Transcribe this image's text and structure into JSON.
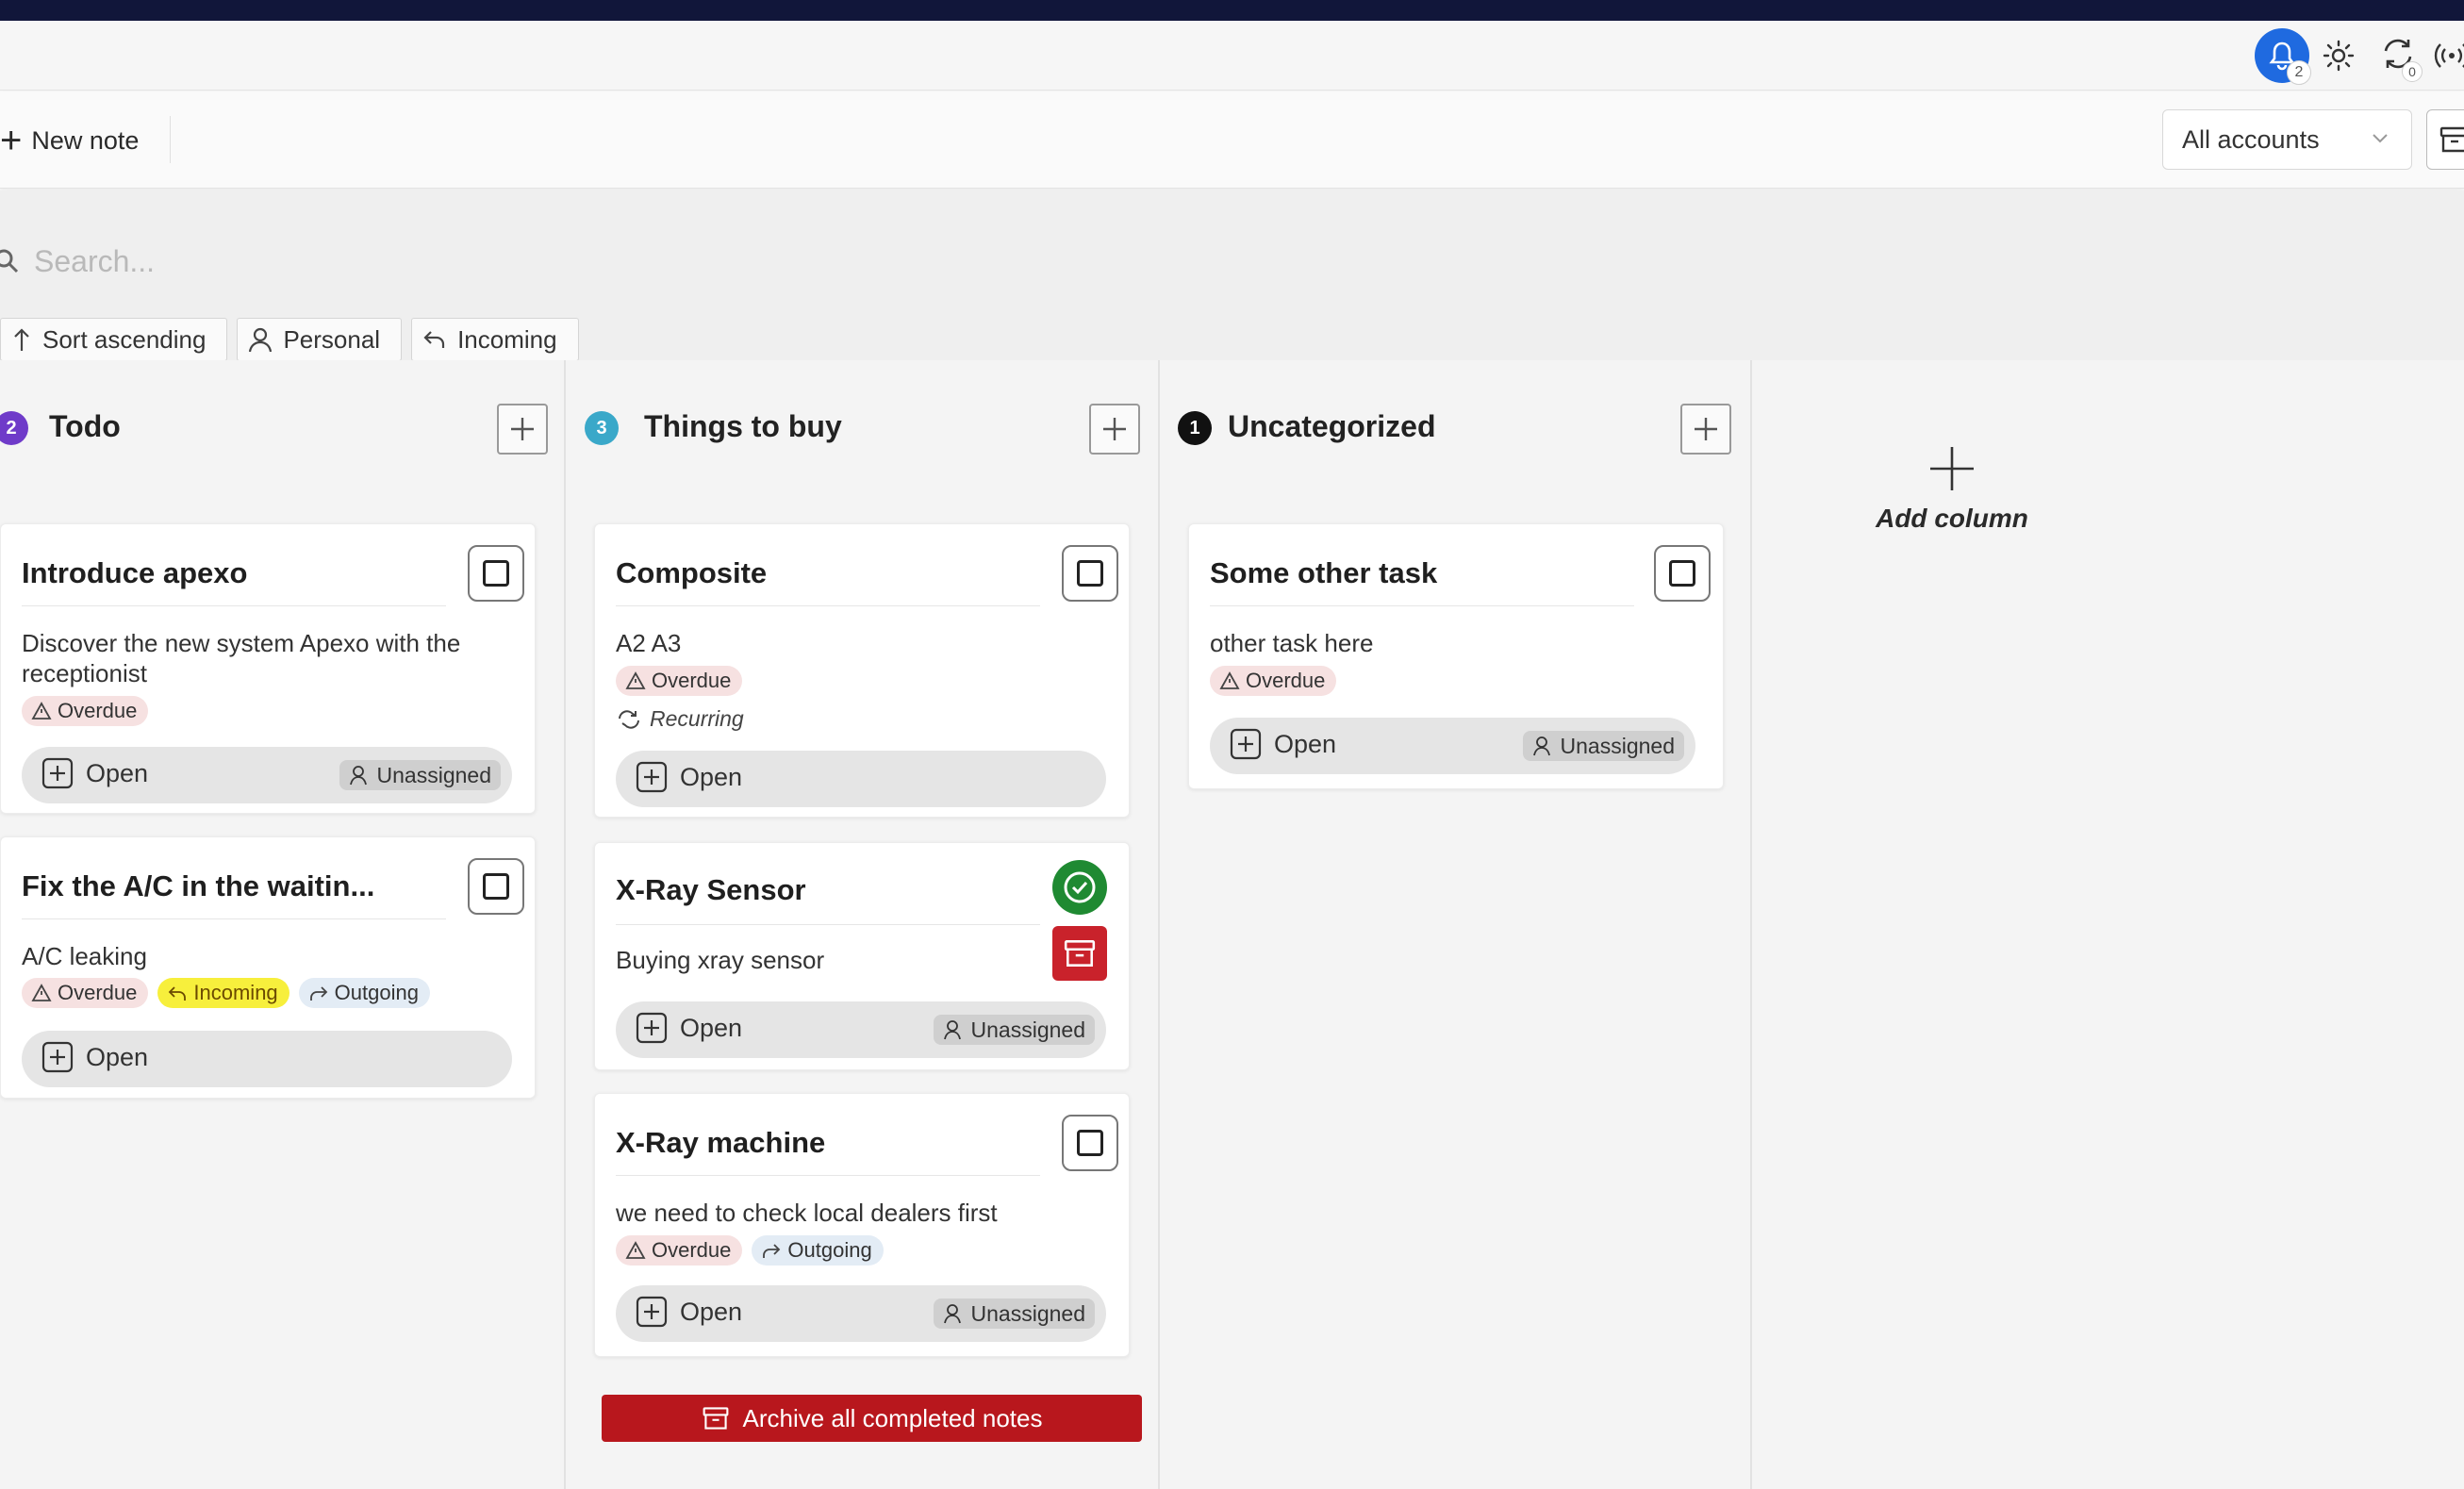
{
  "titlebar": {
    "notifications_count": "2",
    "sync_count": "0"
  },
  "toolbar": {
    "new_note_label": "New note",
    "account_select_value": "All accounts"
  },
  "search": {
    "placeholder": "Search..."
  },
  "filters": [
    {
      "label": "Sort ascending",
      "icon": "arrow-up-icon"
    },
    {
      "label": "Personal",
      "icon": "person-icon"
    },
    {
      "label": "Incoming",
      "icon": "reply-icon"
    }
  ],
  "columns": [
    {
      "title": "Todo",
      "count": "2",
      "count_color": "#6f3bc9",
      "cards": [
        {
          "title": "Introduce apexo",
          "description": "Discover the new system Apexo with the receptionist",
          "tags": [
            "Overdue"
          ],
          "open_label": "Open",
          "assignee": "Unassigned"
        },
        {
          "title": "Fix the A/C in the waitin...",
          "description": "A/C leaking",
          "tags": [
            "Overdue",
            "Incoming",
            "Outgoing"
          ],
          "open_label": "Open"
        }
      ]
    },
    {
      "title": "Things to buy",
      "count": "3",
      "count_color": "#3aa8c9",
      "cards": [
        {
          "title": "Composite",
          "description": "A2 A3",
          "tags": [
            "Overdue"
          ],
          "recurring": "Recurring",
          "open_label": "Open"
        },
        {
          "title": "X-Ray Sensor",
          "description": "Buying xray sensor",
          "open_label": "Open",
          "assignee": "Unassigned"
        },
        {
          "title": "X-Ray machine",
          "description": "we need to check local dealers first",
          "tags": [
            "Overdue",
            "Outgoing"
          ],
          "open_label": "Open",
          "assignee": "Unassigned"
        }
      ],
      "archive_all_label": "Archive all completed notes"
    },
    {
      "title": "Uncategorized",
      "count": "1",
      "count_color": "#111111",
      "cards": [
        {
          "title": "Some other task",
          "description": "other task here",
          "tags": [
            "Overdue"
          ],
          "open_label": "Open",
          "assignee": "Unassigned"
        }
      ]
    }
  ],
  "add_column_label": "Add column",
  "colors": {
    "accent_blue": "#1f6ae0",
    "overdue_bg": "#f6e1e1",
    "incoming_bg": "#f7ef3c",
    "outgoing_bg": "#e3ecf5",
    "done_green": "#1f8a32",
    "archive_red": "#c9222b",
    "archive_all_red": "#b8171d"
  }
}
